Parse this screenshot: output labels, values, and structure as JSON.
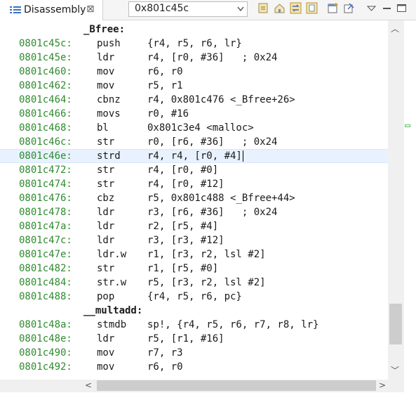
{
  "tab": {
    "title": "Disassembly",
    "close": "⊠"
  },
  "address": {
    "value": "0x801c45c"
  },
  "toolbar_icons": [
    "link-icon",
    "home-icon",
    "sync-icon",
    "copy-icon",
    "new-window-icon",
    "pin-icon",
    "view-menu-icon",
    "minimize-icon",
    "maximize-icon"
  ],
  "lines": [
    {
      "kind": "label",
      "text": "_Bfree:"
    },
    {
      "kind": "instr",
      "addr": "0801c45c:",
      "mn": "push",
      "ops": "{r4, r5, r6, lr}"
    },
    {
      "kind": "instr",
      "addr": "0801c45e:",
      "mn": "ldr",
      "ops": "r4, [r0, #36]   ; 0x24"
    },
    {
      "kind": "instr",
      "addr": "0801c460:",
      "mn": "mov",
      "ops": "r6, r0"
    },
    {
      "kind": "instr",
      "addr": "0801c462:",
      "mn": "mov",
      "ops": "r5, r1"
    },
    {
      "kind": "instr",
      "addr": "0801c464:",
      "mn": "cbnz",
      "ops": "r4, 0x801c476 <_Bfree+26>"
    },
    {
      "kind": "instr",
      "addr": "0801c466:",
      "mn": "movs",
      "ops": "r0, #16"
    },
    {
      "kind": "instr",
      "addr": "0801c468:",
      "mn": "bl",
      "ops": "0x801c3e4 <malloc>"
    },
    {
      "kind": "instr",
      "addr": "0801c46c:",
      "mn": "str",
      "ops": "r0, [r6, #36]   ; 0x24"
    },
    {
      "kind": "instr",
      "addr": "0801c46e:",
      "mn": "strd",
      "ops": "r4, r4, [r0, #4]",
      "current": true
    },
    {
      "kind": "instr",
      "addr": "0801c472:",
      "mn": "str",
      "ops": "r4, [r0, #0]"
    },
    {
      "kind": "instr",
      "addr": "0801c474:",
      "mn": "str",
      "ops": "r4, [r0, #12]"
    },
    {
      "kind": "instr",
      "addr": "0801c476:",
      "mn": "cbz",
      "ops": "r5, 0x801c488 <_Bfree+44>"
    },
    {
      "kind": "instr",
      "addr": "0801c478:",
      "mn": "ldr",
      "ops": "r3, [r6, #36]   ; 0x24"
    },
    {
      "kind": "instr",
      "addr": "0801c47a:",
      "mn": "ldr",
      "ops": "r2, [r5, #4]"
    },
    {
      "kind": "instr",
      "addr": "0801c47c:",
      "mn": "ldr",
      "ops": "r3, [r3, #12]"
    },
    {
      "kind": "instr",
      "addr": "0801c47e:",
      "mn": "ldr.w",
      "ops": "r1, [r3, r2, lsl #2]"
    },
    {
      "kind": "instr",
      "addr": "0801c482:",
      "mn": "str",
      "ops": "r1, [r5, #0]"
    },
    {
      "kind": "instr",
      "addr": "0801c484:",
      "mn": "str.w",
      "ops": "r5, [r3, r2, lsl #2]"
    },
    {
      "kind": "instr",
      "addr": "0801c488:",
      "mn": "pop",
      "ops": "{r4, r5, r6, pc}"
    },
    {
      "kind": "label",
      "text": "__multadd:"
    },
    {
      "kind": "instr",
      "addr": "0801c48a:",
      "mn": "stmdb",
      "ops": "sp!, {r4, r5, r6, r7, r8, lr}"
    },
    {
      "kind": "instr",
      "addr": "0801c48e:",
      "mn": "ldr",
      "ops": "r5, [r1, #16]"
    },
    {
      "kind": "instr",
      "addr": "0801c490:",
      "mn": "mov",
      "ops": "r7, r3"
    },
    {
      "kind": "instr",
      "addr": "0801c492:",
      "mn": "mov",
      "ops": "r6, r0"
    }
  ],
  "colors": {
    "address": "#2e8b2e",
    "current_line": "#e8f2fe"
  }
}
